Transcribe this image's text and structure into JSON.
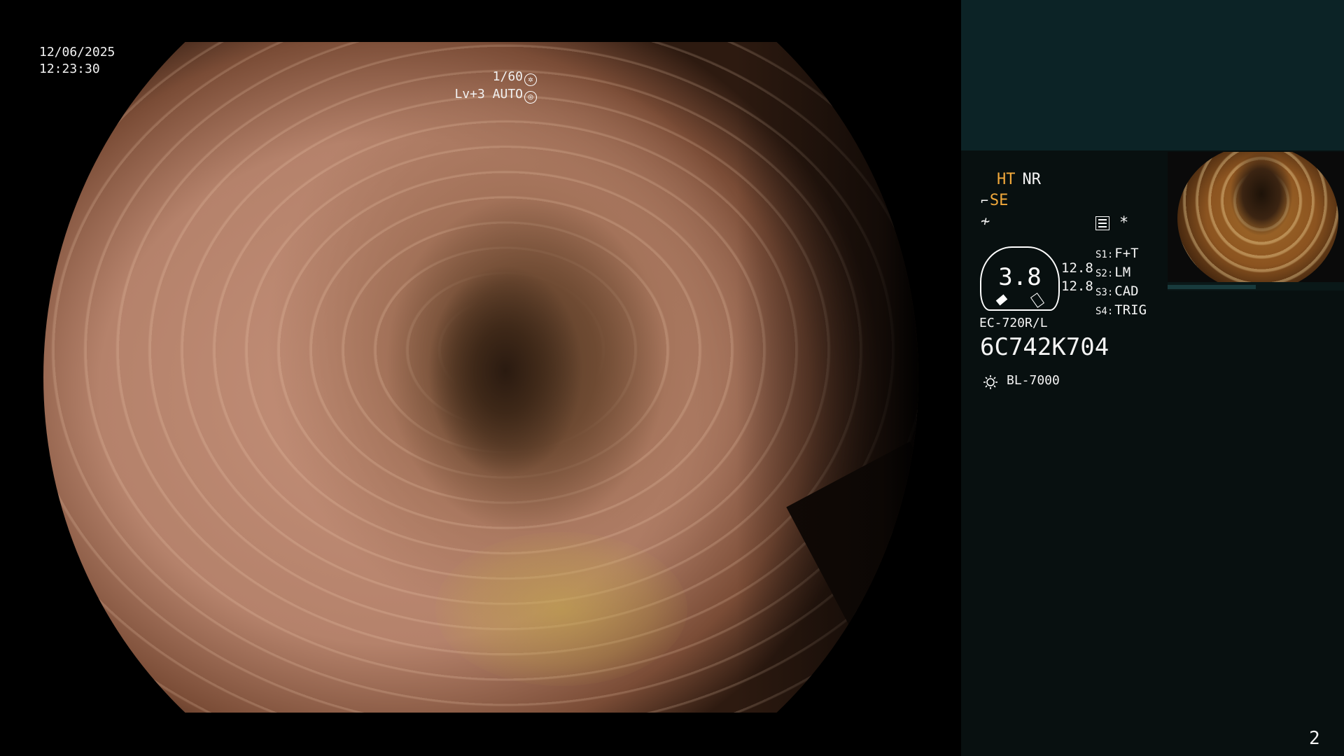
{
  "overlay": {
    "date": "12/06/2025",
    "time": "12:23:30",
    "shutter": "1/60",
    "level": "Lv+3",
    "mode": "AUTO"
  },
  "panel": {
    "ht": "HT",
    "nr": "NR",
    "se": "SE",
    "star": "*",
    "gauge_value": "3.8",
    "gauge_num_1": "12.8",
    "gauge_num_2": "12.8",
    "switches": [
      {
        "label": "S1:",
        "value": "F+T"
      },
      {
        "label": "S2:",
        "value": "LM"
      },
      {
        "label": "S3:",
        "value": "CAD"
      },
      {
        "label": "S4:",
        "value": "TRIG"
      }
    ],
    "scope_model": "EC-720R/L",
    "serial": "6C742K704",
    "light_source": "BL-7000"
  },
  "page_number": "2",
  "colors": {
    "accent_orange": "#f2a93b",
    "panel_top": "#0c2326",
    "panel_bg": "#081010"
  },
  "icons": [
    "shutter-icon",
    "auto-iris-icon",
    "scope-glyph-icon",
    "freeze-icon",
    "menu-icon",
    "light-source-icon"
  ]
}
